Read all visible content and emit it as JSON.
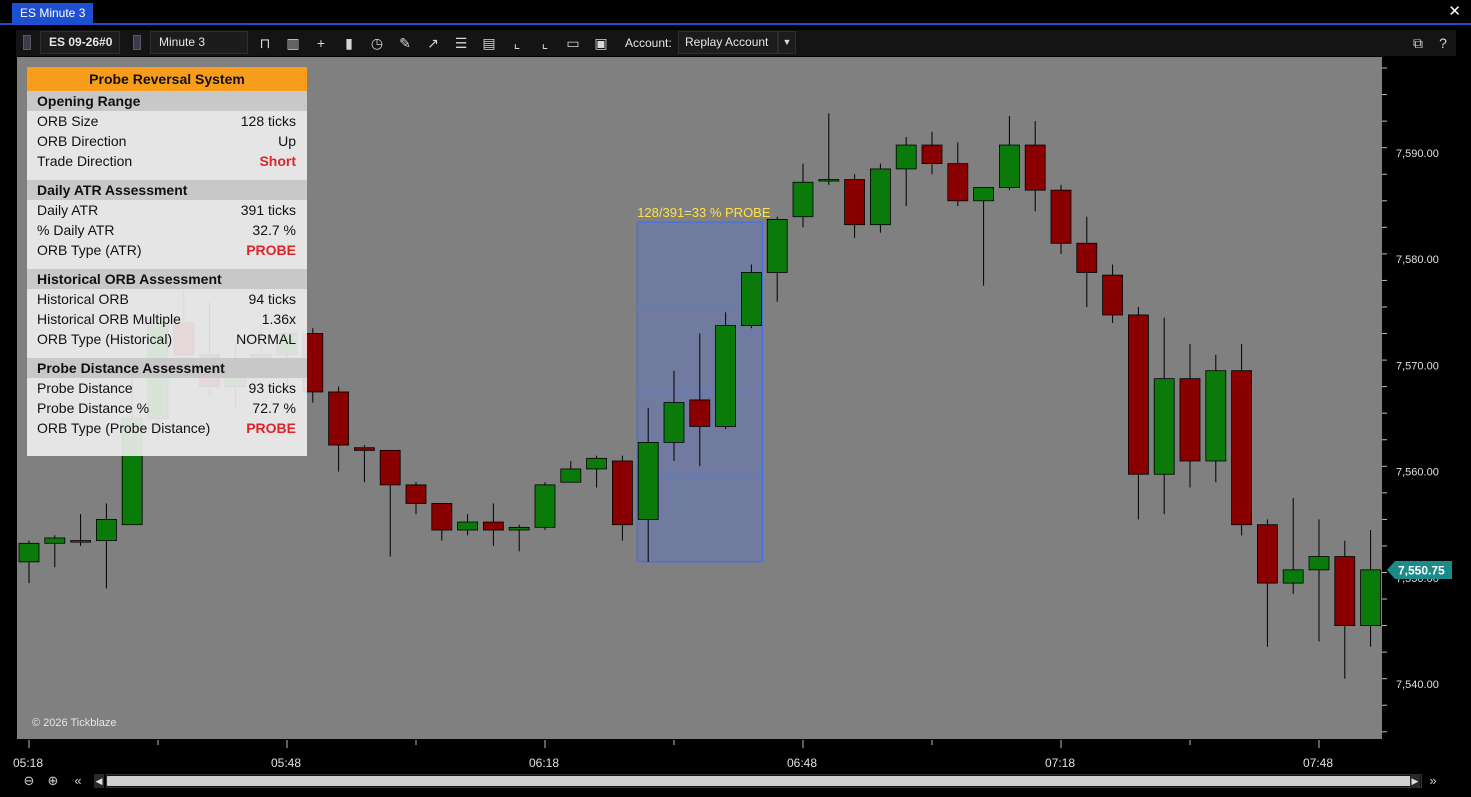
{
  "window": {
    "tab_title": "ES Minute 3",
    "close_glyph": "✕"
  },
  "toolbar": {
    "instrument": "ES 09-26#0",
    "timeframe": "Minute 3",
    "account_label": "Account:",
    "account_value": "Replay Account",
    "icons": [
      "bar-type-icon",
      "chart-style-icon",
      "crosshair-icon",
      "candles-icon",
      "clock-icon",
      "pencil-icon",
      "indicator-icon",
      "list-icon",
      "strategy-icon",
      "axis-icon",
      "axis-alt-icon",
      "folder-icon",
      "save-icon"
    ],
    "help": "?"
  },
  "panel": {
    "title": "Probe Reversal System",
    "sections": [
      {
        "title": "Opening Range",
        "rows": [
          {
            "label": "ORB Size",
            "value": "128 ticks",
            "highlight": false
          },
          {
            "label": "ORB Direction",
            "value": "Up",
            "highlight": false
          },
          {
            "label": "Trade Direction",
            "value": "Short",
            "highlight": true
          }
        ]
      },
      {
        "title": "Daily ATR Assessment",
        "rows": [
          {
            "label": "Daily ATR",
            "value": "391 ticks",
            "highlight": false
          },
          {
            "label": "% Daily ATR",
            "value": "32.7 %",
            "highlight": false
          },
          {
            "label": "ORB Type (ATR)",
            "value": "PROBE",
            "highlight": true
          }
        ]
      },
      {
        "title": "Historical ORB Assessment",
        "rows": [
          {
            "label": "Historical ORB",
            "value": "94 ticks",
            "highlight": false
          },
          {
            "label": "Historical ORB Multiple",
            "value": "1.36x",
            "highlight": false
          },
          {
            "label": "ORB Type (Historical)",
            "value": "NORMAL",
            "highlight": false
          }
        ]
      },
      {
        "title": "Probe Distance Assessment",
        "rows": [
          {
            "label": "Probe Distance",
            "value": "93 ticks",
            "highlight": false
          },
          {
            "label": "Probe Distance %",
            "value": "72.7 %",
            "highlight": false
          },
          {
            "label": "ORB Type (Probe Distance)",
            "value": "PROBE",
            "highlight": true
          }
        ]
      }
    ]
  },
  "chart": {
    "annotation": "128/391=33 % PROBE",
    "current_price": "7,550.75",
    "copyright": "© 2026 Tickblaze",
    "price_ticks": [
      "7,590.00",
      "7,580.00",
      "7,570.00",
      "7,560.00",
      "7,550.00",
      "7,540.00"
    ],
    "time_ticks": [
      "05:18",
      "05:48",
      "06:18",
      "06:48",
      "07:18",
      "07:48"
    ],
    "colors": {
      "up": "#0a7a0a",
      "down": "#8a0000",
      "box": "#6b7aaa",
      "annotation": "#ffe14a",
      "price_tag": "#1a8a8a"
    }
  },
  "chart_data": {
    "type": "candlestick",
    "price_range": [
      7533,
      7599
    ],
    "candles": [
      {
        "o": 7551.5,
        "h": 7553.5,
        "l": 7549.5,
        "c": 7553.25
      },
      {
        "o": 7553.25,
        "h": 7554.0,
        "l": 7551.0,
        "c": 7553.75
      },
      {
        "o": 7553.5,
        "h": 7556.0,
        "l": 7553.0,
        "c": 7553.5
      },
      {
        "o": 7553.5,
        "h": 7557.0,
        "l": 7549.0,
        "c": 7555.5
      },
      {
        "o": 7555.0,
        "h": 7569.0,
        "l": 7556.0,
        "c": 7565.0
      },
      {
        "o": 7565.0,
        "h": 7575.0,
        "l": 7563.0,
        "c": 7574.0
      },
      {
        "o": 7574.0,
        "h": 7577.0,
        "l": 7572.0,
        "c": 7571.0
      },
      {
        "o": 7571.0,
        "h": 7576.0,
        "l": 7567.0,
        "c": 7568.0
      },
      {
        "o": 7568.0,
        "h": 7572.0,
        "l": 7566.0,
        "c": 7570.0
      },
      {
        "o": 7570.0,
        "h": 7574.0,
        "l": 7569.0,
        "c": 7571.0
      },
      {
        "o": 7571.0,
        "h": 7573.0,
        "l": 7568.0,
        "c": 7573.0
      },
      {
        "o": 7573.0,
        "h": 7573.5,
        "l": 7566.5,
        "c": 7567.5
      },
      {
        "o": 7567.5,
        "h": 7568.0,
        "l": 7560.0,
        "c": 7562.5
      },
      {
        "o": 7562.25,
        "h": 7562.5,
        "l": 7559.0,
        "c": 7562.0
      },
      {
        "o": 7562.0,
        "h": 7562.0,
        "l": 7552.0,
        "c": 7558.75
      },
      {
        "o": 7558.75,
        "h": 7559.0,
        "l": 7556.0,
        "c": 7557.0
      },
      {
        "o": 7557.0,
        "h": 7557.0,
        "l": 7553.5,
        "c": 7554.5
      },
      {
        "o": 7554.5,
        "h": 7556.0,
        "l": 7554.0,
        "c": 7555.25
      },
      {
        "o": 7555.25,
        "h": 7557.0,
        "l": 7553.0,
        "c": 7554.5
      },
      {
        "o": 7554.5,
        "h": 7555.0,
        "l": 7552.5,
        "c": 7554.75
      },
      {
        "o": 7554.75,
        "h": 7559.0,
        "l": 7554.5,
        "c": 7558.75
      },
      {
        "o": 7559.0,
        "h": 7561.0,
        "l": 7559.0,
        "c": 7560.25
      },
      {
        "o": 7560.25,
        "h": 7561.5,
        "l": 7558.5,
        "c": 7561.25
      },
      {
        "o": 7561.0,
        "h": 7561.5,
        "l": 7553.5,
        "c": 7555.0
      },
      {
        "o": 7555.5,
        "h": 7566.0,
        "l": 7551.5,
        "c": 7562.75
      },
      {
        "o": 7562.75,
        "h": 7569.5,
        "l": 7561.0,
        "c": 7566.5
      },
      {
        "o": 7566.75,
        "h": 7573.0,
        "l": 7560.5,
        "c": 7564.25
      },
      {
        "o": 7564.25,
        "h": 7575.0,
        "l": 7564.0,
        "c": 7573.75
      },
      {
        "o": 7573.75,
        "h": 7579.5,
        "l": 7573.5,
        "c": 7578.75
      },
      {
        "o": 7578.75,
        "h": 7584.0,
        "l": 7576.0,
        "c": 7583.75
      },
      {
        "o": 7584.0,
        "h": 7589.0,
        "l": 7583.0,
        "c": 7587.25
      },
      {
        "o": 7587.5,
        "h": 7593.75,
        "l": 7587.0,
        "c": 7587.5
      },
      {
        "o": 7587.5,
        "h": 7588.0,
        "l": 7582.0,
        "c": 7583.25
      },
      {
        "o": 7583.25,
        "h": 7589.0,
        "l": 7582.5,
        "c": 7588.5
      },
      {
        "o": 7588.5,
        "h": 7591.5,
        "l": 7585.0,
        "c": 7590.75
      },
      {
        "o": 7590.75,
        "h": 7592.0,
        "l": 7588.0,
        "c": 7589.0
      },
      {
        "o": 7589.0,
        "h": 7591.0,
        "l": 7585.0,
        "c": 7585.5
      },
      {
        "o": 7585.5,
        "h": 7586.5,
        "l": 7577.5,
        "c": 7586.75
      },
      {
        "o": 7586.75,
        "h": 7593.5,
        "l": 7586.5,
        "c": 7590.75
      },
      {
        "o": 7590.75,
        "h": 7593.0,
        "l": 7584.5,
        "c": 7586.5
      },
      {
        "o": 7586.5,
        "h": 7587.0,
        "l": 7580.5,
        "c": 7581.5
      },
      {
        "o": 7581.5,
        "h": 7584.0,
        "l": 7575.5,
        "c": 7578.75
      },
      {
        "o": 7578.5,
        "h": 7579.5,
        "l": 7574.0,
        "c": 7574.75
      },
      {
        "o": 7574.75,
        "h": 7575.5,
        "l": 7555.5,
        "c": 7559.75
      },
      {
        "o": 7559.75,
        "h": 7574.5,
        "l": 7556.0,
        "c": 7568.75
      },
      {
        "o": 7568.75,
        "h": 7572.0,
        "l": 7558.5,
        "c": 7561.0
      },
      {
        "o": 7561.0,
        "h": 7571.0,
        "l": 7559.0,
        "c": 7569.5
      },
      {
        "o": 7569.5,
        "h": 7572.0,
        "l": 7554.0,
        "c": 7555.0
      },
      {
        "o": 7555.0,
        "h": 7555.5,
        "l": 7543.5,
        "c": 7549.5
      },
      {
        "o": 7549.5,
        "h": 7557.5,
        "l": 7548.5,
        "c": 7550.75
      },
      {
        "o": 7550.75,
        "h": 7555.5,
        "l": 7544.0,
        "c": 7552.0
      },
      {
        "o": 7552.0,
        "h": 7553.5,
        "l": 7540.5,
        "c": 7545.5
      },
      {
        "o": 7545.5,
        "h": 7554.5,
        "l": 7543.5,
        "c": 7550.75
      }
    ],
    "probe_box": {
      "price_high": 7583.5,
      "price_low": 7551.5,
      "mid_lines": [
        7575.5,
        7567.5,
        7559.5
      ],
      "first_candle": 24,
      "last_candle": 28
    }
  }
}
